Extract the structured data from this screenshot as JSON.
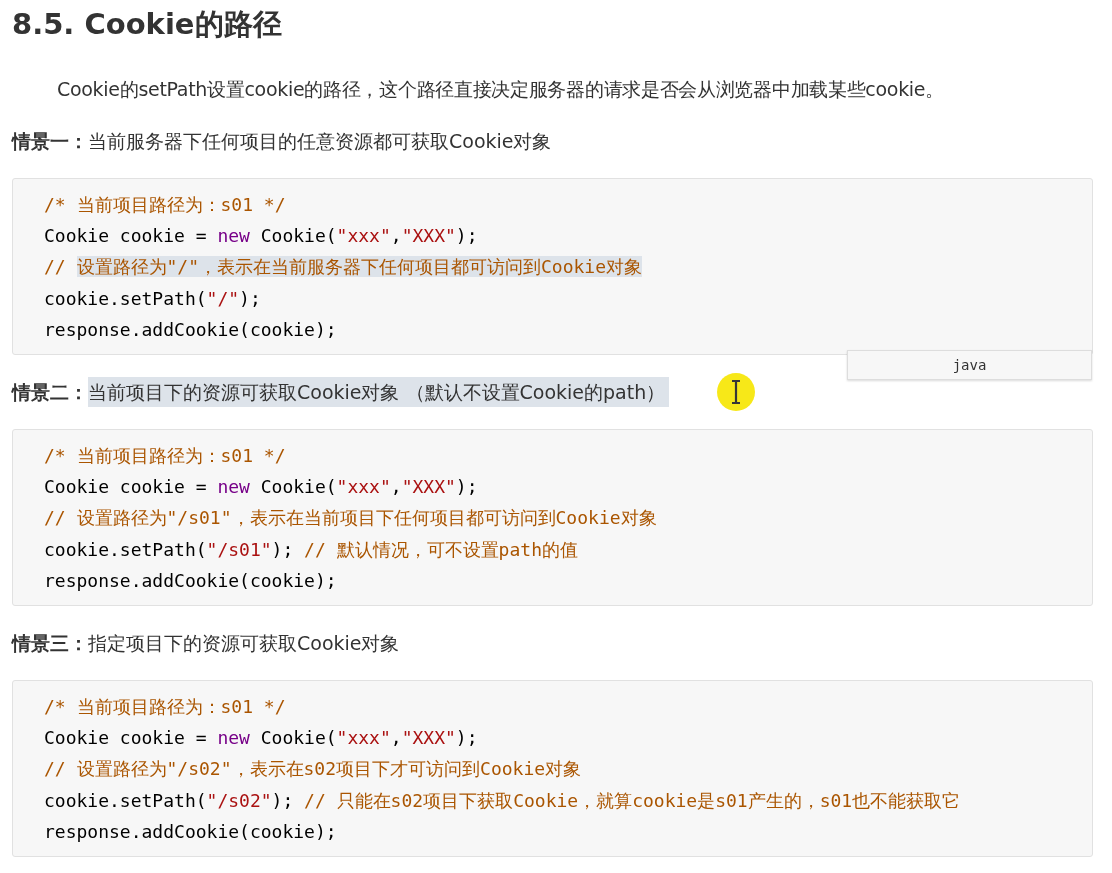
{
  "heading": "8.5. Cookie的路径",
  "intro": "Cookie的setPath设置cookie的路径，这个路径直接决定服务器的请求是否会从浏览器中加载某些cookie。",
  "language_tag": "java",
  "sections": [
    {
      "label": "情景一：",
      "text": "当前服务器下任何项目的任意资源都可获取Cookie对象",
      "selected": false,
      "code": [
        [
          {
            "kind": "comment",
            "text": "/* 当前项目路径为：s01 */",
            "selected": false
          }
        ],
        [
          {
            "kind": "plain",
            "text": "Cookie cookie = ",
            "selected": false
          },
          {
            "kind": "keyword",
            "text": "new",
            "selected": false
          },
          {
            "kind": "plain",
            "text": " Cookie(",
            "selected": false
          },
          {
            "kind": "string",
            "text": "\"xxx\"",
            "selected": false
          },
          {
            "kind": "plain",
            "text": ",",
            "selected": false
          },
          {
            "kind": "string",
            "text": "\"XXX\"",
            "selected": false
          },
          {
            "kind": "plain",
            "text": ");",
            "selected": false
          }
        ],
        [
          {
            "kind": "comment",
            "text": "// ",
            "selected": false
          },
          {
            "kind": "comment",
            "text": "设置路径为\"/\"，表示在当前服务器下任何项目都可访问到Cookie对象",
            "selected": true
          }
        ],
        [
          {
            "kind": "plain",
            "text": "cookie.setPath(",
            "selected": false
          },
          {
            "kind": "string",
            "text": "\"/\"",
            "selected": false
          },
          {
            "kind": "plain",
            "text": ");",
            "selected": false
          }
        ],
        [
          {
            "kind": "plain",
            "text": "response.addCookie(cookie);",
            "selected": false
          }
        ]
      ]
    },
    {
      "label": "情景二：",
      "text": "当前项目下的资源可获取Cookie对象 （默认不设置Cookie的path）",
      "selected": true,
      "code": [
        [
          {
            "kind": "comment",
            "text": "/* 当前项目路径为：s01 */",
            "selected": false
          }
        ],
        [
          {
            "kind": "plain",
            "text": "Cookie cookie = ",
            "selected": false
          },
          {
            "kind": "keyword",
            "text": "new",
            "selected": false
          },
          {
            "kind": "plain",
            "text": " Cookie(",
            "selected": false
          },
          {
            "kind": "string",
            "text": "\"xxx\"",
            "selected": false
          },
          {
            "kind": "plain",
            "text": ",",
            "selected": false
          },
          {
            "kind": "string",
            "text": "\"XXX\"",
            "selected": false
          },
          {
            "kind": "plain",
            "text": ");",
            "selected": false
          }
        ],
        [
          {
            "kind": "comment",
            "text": "// 设置路径为\"/s01\"，表示在当前项目下任何项目都可访问到Cookie对象",
            "selected": false
          }
        ],
        [
          {
            "kind": "plain",
            "text": "cookie.setPath(",
            "selected": false
          },
          {
            "kind": "string",
            "text": "\"/s01\"",
            "selected": false
          },
          {
            "kind": "plain",
            "text": "); ",
            "selected": false
          },
          {
            "kind": "comment",
            "text": "// 默认情况，可不设置path的值",
            "selected": false
          }
        ],
        [
          {
            "kind": "plain",
            "text": "response.addCookie(cookie);",
            "selected": false
          }
        ]
      ]
    },
    {
      "label": "情景三：",
      "text": "指定项目下的资源可获取Cookie对象",
      "selected": false,
      "code": [
        [
          {
            "kind": "comment",
            "text": "/* 当前项目路径为：s01 */",
            "selected": false
          }
        ],
        [
          {
            "kind": "plain",
            "text": "Cookie cookie = ",
            "selected": false
          },
          {
            "kind": "keyword",
            "text": "new",
            "selected": false
          },
          {
            "kind": "plain",
            "text": " Cookie(",
            "selected": false
          },
          {
            "kind": "string",
            "text": "\"xxx\"",
            "selected": false
          },
          {
            "kind": "plain",
            "text": ",",
            "selected": false
          },
          {
            "kind": "string",
            "text": "\"XXX\"",
            "selected": false
          },
          {
            "kind": "plain",
            "text": ");",
            "selected": false
          }
        ],
        [
          {
            "kind": "comment",
            "text": "// 设置路径为\"/s02\"，表示在s02项目下才可访问到Cookie对象",
            "selected": false
          }
        ],
        [
          {
            "kind": "plain",
            "text": "cookie.setPath(",
            "selected": false
          },
          {
            "kind": "string",
            "text": "\"/s02\"",
            "selected": false
          },
          {
            "kind": "plain",
            "text": "); ",
            "selected": false
          },
          {
            "kind": "comment",
            "text": "// 只能在s02项目下获取Cookie，就算cookie是s01产生的，s01也不能获取它",
            "selected": false
          }
        ],
        [
          {
            "kind": "plain",
            "text": "response.addCookie(cookie);",
            "selected": false
          }
        ]
      ]
    }
  ]
}
